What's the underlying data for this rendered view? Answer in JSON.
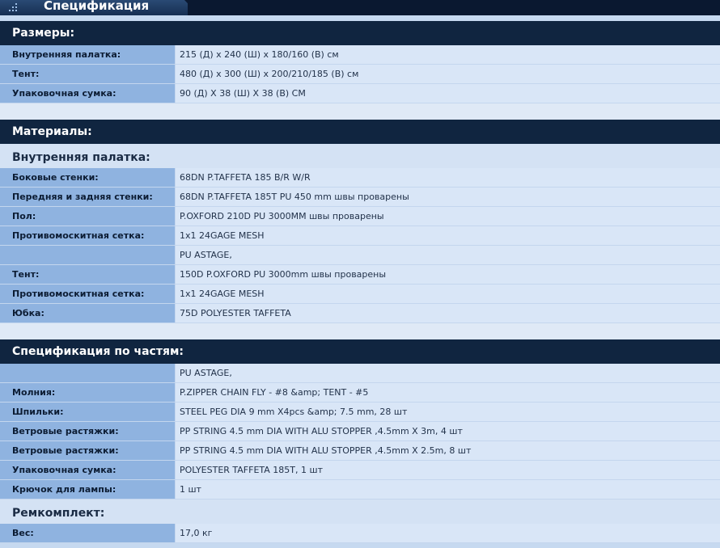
{
  "header": {
    "title": "Спецификация"
  },
  "sections": {
    "sizes": {
      "title": "Размеры:",
      "rows": [
        {
          "label": "Внутренняя палатка:",
          "value": "215 (Д) x 240 (Ш) x 180/160 (В) см"
        },
        {
          "label": "Тент:",
          "value": "480 (Д) x 300 (Ш) x 200/210/185 (В) см"
        },
        {
          "label": "Упаковочная сумка:",
          "value": "90 (Д) X 38 (Ш) X 38 (В) СМ"
        }
      ]
    },
    "materials": {
      "title": "Материалы:",
      "subheading": "Внутренняя палатка:",
      "rows": [
        {
          "label": "Боковые стенки:",
          "value": "68DN P.TAFFETA 185 B/R W/R"
        },
        {
          "label": "Передняя и задняя стенки:",
          "value": "68DN P.TAFFETA 185T PU 450 mm швы проварены"
        },
        {
          "label": "Пол:",
          "value": "P.OXFORD 210D PU 3000MM швы проварены"
        },
        {
          "label": "Противомоскитная сетка:",
          "value": "1x1 24GAGE MESH"
        },
        {
          "label": "",
          "value": "PU ASTAGE,"
        },
        {
          "label": "Тент:",
          "value": "150D P.OXFORD PU 3000mm швы проварены"
        },
        {
          "label": "Противомоскитная сетка:",
          "value": "1x1 24GAGE MESH"
        },
        {
          "label": "Юбка:",
          "value": "75D POLYESTER TAFFETA"
        }
      ]
    },
    "parts": {
      "title": "Спецификация по частям:",
      "rows": [
        {
          "label": "",
          "value": "PU ASTAGE,"
        },
        {
          "label": "Молния:",
          "value": "P.ZIPPER CHAIN FLY - #8 &amp; TENT - #5"
        },
        {
          "label": "Шпильки:",
          "value": "STEEL PEG DIA 9 mm X4pcs &amp; 7.5 mm, 28 шт"
        },
        {
          "label": "Ветровые растяжки:",
          "value": "PP STRING 4.5 mm DIA WITH ALU STOPPER ,4.5mm X 3m, 4 шт"
        },
        {
          "label": "Ветровые растяжки:",
          "value": "PP STRING 4.5 mm DIA WITH ALU STOPPER ,4.5mm X 2.5m, 8 шт"
        },
        {
          "label": "Упаковочная сумка:",
          "value": "POLYESTER TAFFETA 185T, 1 шт"
        },
        {
          "label": "Крючок для лампы:",
          "value": "1 шт"
        }
      ],
      "subheading": "Ремкомплект:",
      "rows2": [
        {
          "label": "Вес:",
          "value": "17,0 кг"
        }
      ]
    }
  }
}
